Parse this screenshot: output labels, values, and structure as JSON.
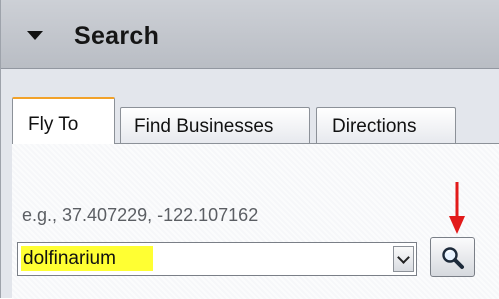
{
  "header": {
    "title": "Search",
    "toggle_icon": "triangle-down-icon"
  },
  "tabs": [
    {
      "label": "Fly To",
      "active": true
    },
    {
      "label": "Find Businesses",
      "active": false
    },
    {
      "label": "Directions",
      "active": false
    }
  ],
  "fly_to": {
    "hint": "e.g., 37.407229, -122.107162",
    "query": "dolfinarium",
    "query_highlight_color": "#ffff33",
    "search_icon": "magnifier-icon",
    "annotation_icon": "red-arrow-down-icon",
    "annotation_color": "#e21a1a"
  },
  "colors": {
    "active_tab_accent": "#f2a22a",
    "header_bg": "#c4c7cd"
  }
}
